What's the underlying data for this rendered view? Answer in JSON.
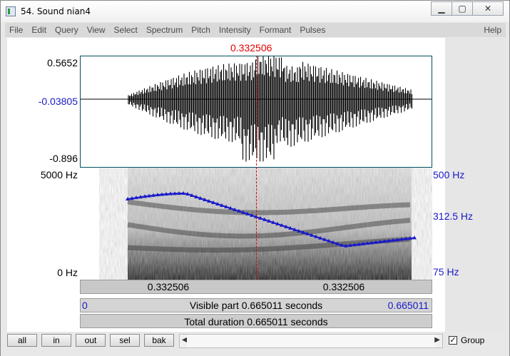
{
  "window": {
    "title": "54. Sound nian4",
    "controls": [
      "minimize-icon",
      "maximize-icon",
      "close-icon"
    ]
  },
  "menu": {
    "items": [
      "File",
      "Edit",
      "Query",
      "View",
      "Select",
      "Spectrum",
      "Pitch",
      "Intensity",
      "Formant",
      "Pulses"
    ],
    "help": "Help"
  },
  "cursor": {
    "time": "0.332506",
    "color": "#e00000"
  },
  "waveform": {
    "max": "0.5652",
    "mid": "-0.03805",
    "min": "-0.896"
  },
  "spectrogram": {
    "top_freq": "5000 Hz",
    "bottom_freq": "0 Hz"
  },
  "pitch": {
    "top": "500 Hz",
    "mid": "312.5 Hz",
    "bottom": "75 Hz",
    "color": "#1a1ac8"
  },
  "selection": {
    "left": "0.332506",
    "right": "0.332506"
  },
  "visible": {
    "start": "0",
    "label": "Visible part 0.665011 seconds",
    "end": "0.665011"
  },
  "total": {
    "label": "Total duration 0.665011 seconds"
  },
  "buttons": {
    "all": "all",
    "in": "in",
    "out": "out",
    "sel": "sel",
    "bak": "bak"
  },
  "group": {
    "label": "Group",
    "checked": true
  }
}
